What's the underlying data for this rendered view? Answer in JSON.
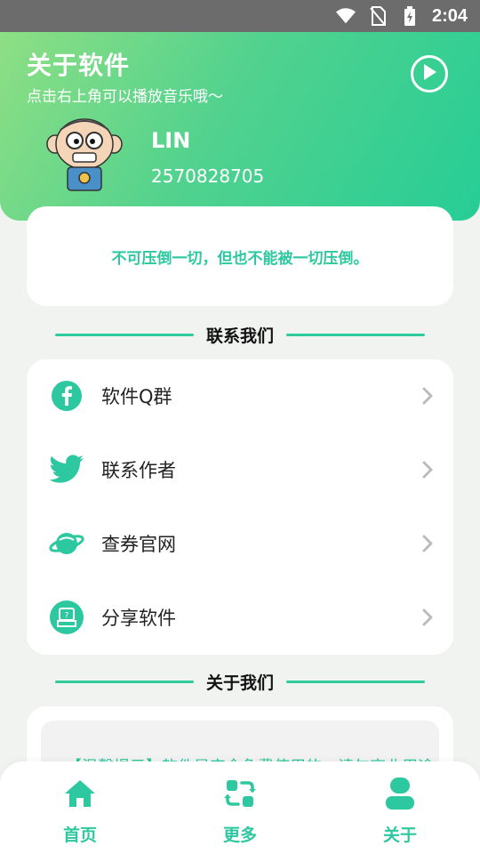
{
  "status_bar": {
    "time": "2:04"
  },
  "header": {
    "title": "关于软件",
    "subtitle": "点击右上角可以播放音乐哦～",
    "play_icon": "play-circle-icon"
  },
  "profile": {
    "name": "LIN",
    "id": "2570828705",
    "avatar_icon": "cartoon-avatar"
  },
  "quote": "不可压倒一切，但也不能被一切压倒。",
  "contact_section": {
    "title": "联系我们",
    "items": [
      {
        "label": "软件Q群",
        "icon": "facebook-icon"
      },
      {
        "label": "联系作者",
        "icon": "twitter-icon"
      },
      {
        "label": "查券官网",
        "icon": "planet-icon"
      },
      {
        "label": "分享软件",
        "icon": "share-box-icon"
      }
    ]
  },
  "about_section": {
    "title": "关于我们",
    "text": "【温馨提示】软件是完全免费使用的，请勿商业用途…"
  },
  "bottom_nav": {
    "items": [
      {
        "label": "首页",
        "icon": "home-icon"
      },
      {
        "label": "更多",
        "icon": "refresh-icon"
      },
      {
        "label": "关于",
        "icon": "user-icon"
      }
    ]
  },
  "colors": {
    "accent": "#2ec8a0",
    "header_start": "#8edf84",
    "header_end": "#26cd96",
    "background": "#f1f3f1"
  }
}
